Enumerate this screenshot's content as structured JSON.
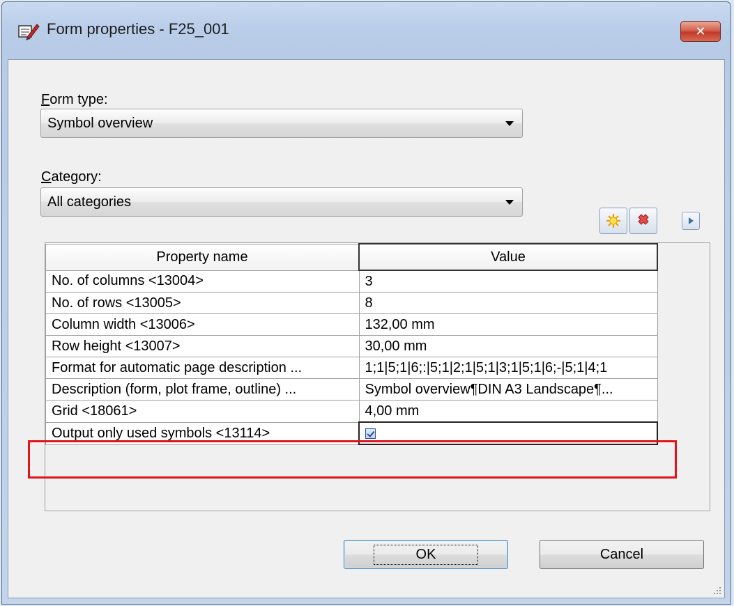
{
  "window": {
    "title": "Form properties - F25_001",
    "close_glyph": "✕"
  },
  "form_type": {
    "label_prefix": "F",
    "label_rest": "orm type:",
    "selected": "Symbol overview"
  },
  "category": {
    "label_prefix": "C",
    "label_rest": "ategory:",
    "selected": "All categories"
  },
  "toolbar": {
    "new_icon": "new-star-icon",
    "delete_icon": "delete-x-icon",
    "expand_icon": "arrow-right-icon"
  },
  "table": {
    "headers": [
      "Property name",
      "Value"
    ],
    "rows": [
      {
        "name": "No. of columns <13004>",
        "value": "3"
      },
      {
        "name": "No. of rows <13005>",
        "value": "8"
      },
      {
        "name": "Column width <13006>",
        "value": "132,00 mm"
      },
      {
        "name": "Row height <13007>",
        "value": "30,00 mm"
      },
      {
        "name": "Format for automatic page description ...",
        "value": "1;1|5;1|6;:|5;1|2;1|5;1|3;1|5;1|6;-|5;1|4;1"
      },
      {
        "name": "Description (form, plot frame, outline) ...",
        "value": "Symbol overview¶DIN A3 Landscape¶..."
      },
      {
        "name": "Grid <18061>",
        "value": "4,00 mm"
      },
      {
        "name": "Output only used symbols <13114>",
        "checked": true
      }
    ]
  },
  "buttons": {
    "ok": "OK",
    "cancel": "Cancel"
  },
  "colors": {
    "highlight": "#e0141b",
    "close": "#c0392b"
  }
}
